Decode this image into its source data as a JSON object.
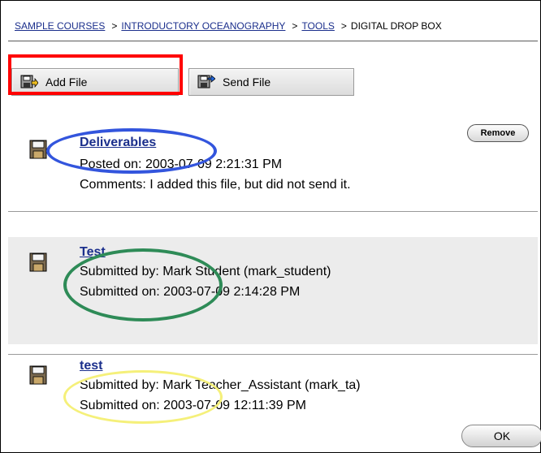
{
  "breadcrumb": {
    "items": [
      "SAMPLE COURSES",
      "INTRODUCTORY OCEANOGRAPHY",
      "TOOLS"
    ],
    "separator": ">",
    "current": "DIGITAL DROP BOX"
  },
  "toolbar": {
    "add_label": "Add File",
    "send_label": "Send File"
  },
  "files": [
    {
      "title": "Deliverables",
      "line1": "Posted on: 2003-07-09 2:21:31 PM",
      "line2": "Comments: I added this file, but did not send it.",
      "action": "Remove"
    },
    {
      "title": "Test",
      "line1": "Submitted by: Mark Student (mark_student)",
      "line2": "Submitted on: 2003-07-09 2:14:28 PM"
    },
    {
      "title": "test",
      "line1": "Submitted by: Mark Teacher_Assistant (mark_ta)",
      "line2": "Submitted on: 2003-07-09 12:11:39 PM"
    }
  ],
  "footer": {
    "ok_label": "OK"
  },
  "colors": {
    "link": "#1b2f8c",
    "highlight_add": "#ff0000",
    "highlight_deliverables": "#3355dd",
    "highlight_test": "#2e8b57",
    "highlight_test_lower": "#f5f07a",
    "row_alt": "#ececec"
  }
}
